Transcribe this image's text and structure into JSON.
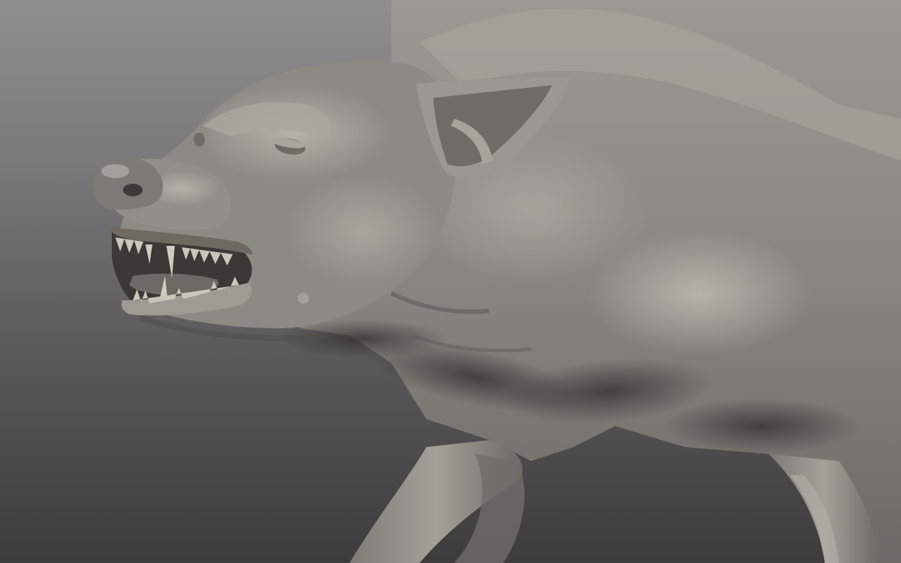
{
  "scene": {
    "subject": "sculpt-model",
    "background_gradient": [
      "#8f8f8f",
      "#7a7a7a",
      "#5a5a5a",
      "#3c3c3c"
    ],
    "material_colors": {
      "base": "#8e8c86",
      "highlight": "#b7b5ae",
      "shadow": "#4c4b47",
      "deep_shadow": "#2e2d2b",
      "tooth": "#c9c6bb",
      "gum": "#6e6a62"
    }
  }
}
